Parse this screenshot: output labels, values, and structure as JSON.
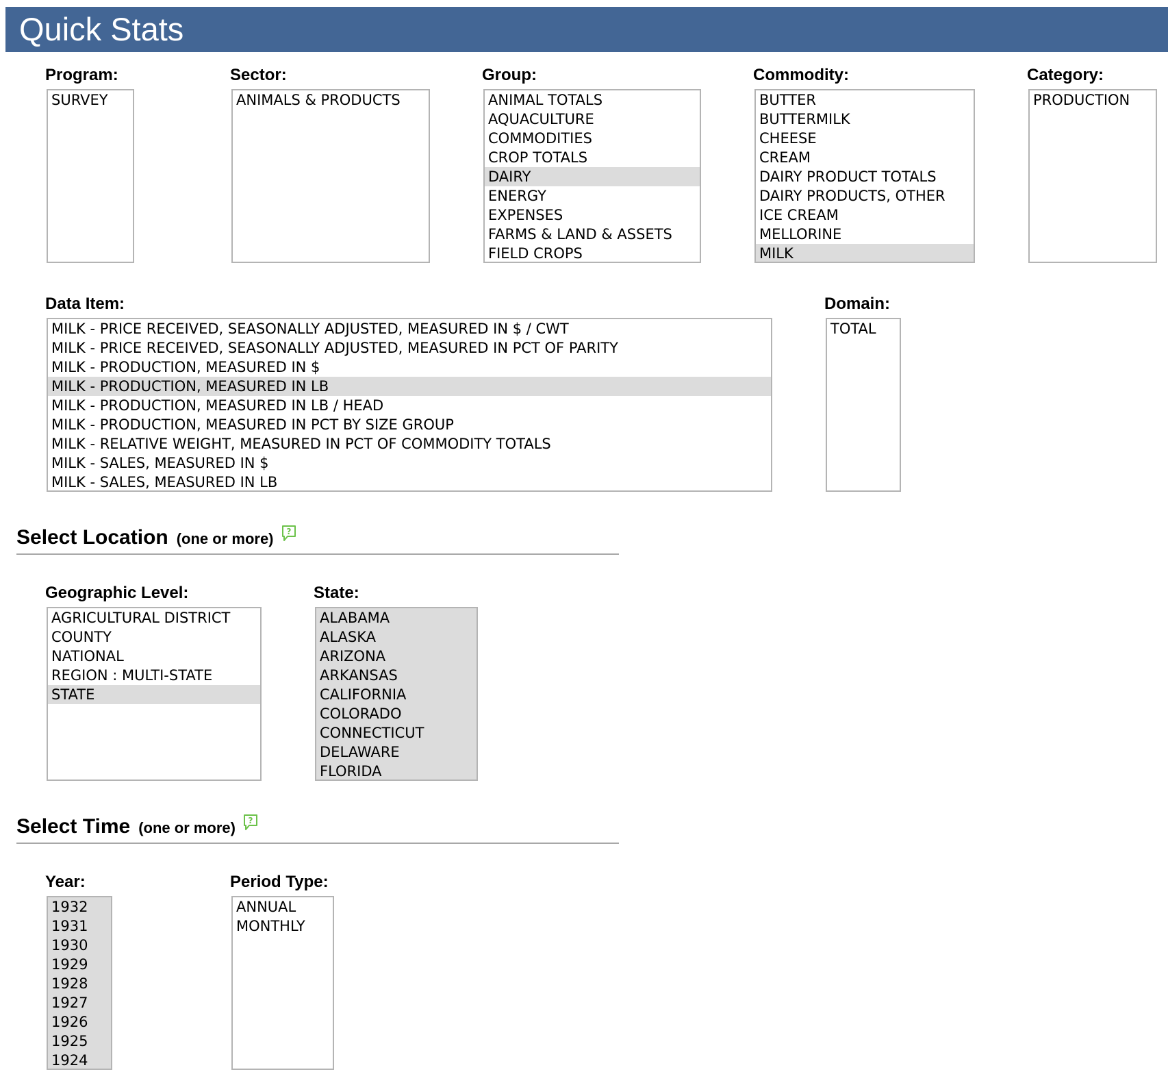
{
  "header": {
    "title": "Quick Stats"
  },
  "program": {
    "label": "Program:",
    "options": [
      "SURVEY"
    ]
  },
  "sector": {
    "label": "Sector:",
    "options": [
      "ANIMALS & PRODUCTS"
    ]
  },
  "group": {
    "label": "Group:",
    "options": [
      "ANIMAL TOTALS",
      "AQUACULTURE",
      "COMMODITIES",
      "CROP TOTALS",
      "DAIRY",
      "ENERGY",
      "EXPENSES",
      "FARMS & LAND & ASSETS",
      "FIELD CROPS"
    ],
    "selected": "DAIRY"
  },
  "commodity": {
    "label": "Commodity:",
    "options": [
      "BUTTER",
      "BUTTERMILK",
      "CHEESE",
      "CREAM",
      "DAIRY PRODUCT TOTALS",
      "DAIRY PRODUCTS, OTHER",
      "ICE CREAM",
      "MELLORINE",
      "MILK"
    ],
    "selected": "MILK"
  },
  "category": {
    "label": "Category:",
    "options": [
      "PRODUCTION"
    ]
  },
  "data_item": {
    "label": "Data Item:",
    "options": [
      "MILK - PRICE RECEIVED, SEASONALLY ADJUSTED, MEASURED IN $ / CWT",
      "MILK - PRICE RECEIVED, SEASONALLY ADJUSTED, MEASURED IN PCT OF PARITY",
      "MILK - PRODUCTION, MEASURED IN $",
      "MILK - PRODUCTION, MEASURED IN LB",
      "MILK - PRODUCTION, MEASURED IN LB / HEAD",
      "MILK - PRODUCTION, MEASURED IN PCT BY SIZE GROUP",
      "MILK - RELATIVE WEIGHT, MEASURED IN PCT OF COMMODITY TOTALS",
      "MILK - SALES, MEASURED IN $",
      "MILK - SALES, MEASURED IN LB"
    ],
    "selected": "MILK - PRODUCTION, MEASURED IN LB"
  },
  "domain": {
    "label": "Domain:",
    "options": [
      "TOTAL"
    ]
  },
  "location_section": {
    "title": "Select Location",
    "subtitle": "(one or more)",
    "help_icon": "help-speech-bubble-icon"
  },
  "geo_level": {
    "label": "Geographic Level:",
    "options": [
      "AGRICULTURAL DISTRICT",
      "COUNTY",
      "NATIONAL",
      "REGION : MULTI-STATE",
      "STATE"
    ],
    "selected": "STATE"
  },
  "state": {
    "label": "State:",
    "options": [
      "ALABAMA",
      "ALASKA",
      "ARIZONA",
      "ARKANSAS",
      "CALIFORNIA",
      "COLORADO",
      "CONNECTICUT",
      "DELAWARE",
      "FLORIDA"
    ],
    "all_selected": true
  },
  "time_section": {
    "title": "Select Time",
    "subtitle": "(one or more)",
    "help_icon": "help-speech-bubble-icon"
  },
  "year": {
    "label": "Year:",
    "options": [
      "1932",
      "1931",
      "1930",
      "1929",
      "1928",
      "1927",
      "1926",
      "1925",
      "1924"
    ],
    "all_selected": true
  },
  "period_type": {
    "label": "Period Type:",
    "options": [
      "ANNUAL",
      "MONTHLY"
    ]
  },
  "colors": {
    "header_bg": "#436695",
    "selected_bg": "#dcdcdc",
    "help_icon": "#6cc24a",
    "border": "#b4b4b4"
  }
}
